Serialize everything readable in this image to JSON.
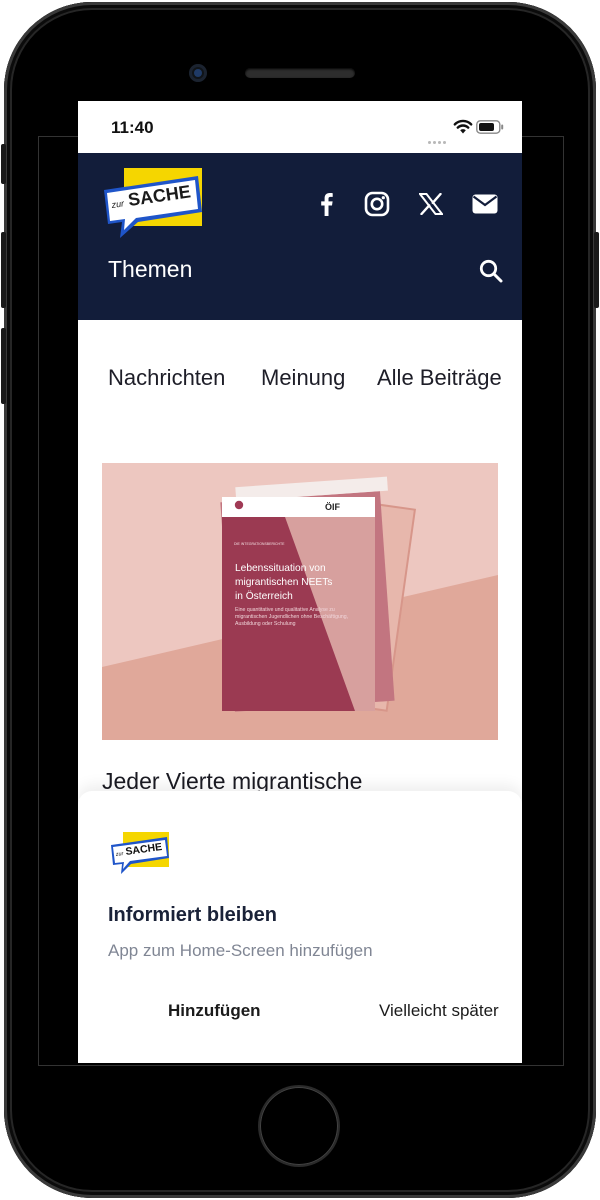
{
  "status_bar": {
    "time": "11:40"
  },
  "header": {
    "logo_text_small": "zur",
    "logo_text_main": "SACHE",
    "social_icons": [
      "facebook-icon",
      "instagram-icon",
      "x-icon",
      "mail-icon"
    ],
    "menu_label": "Themen",
    "search_icon": "search-icon"
  },
  "nav": {
    "items": [
      "Nachrichten",
      "Meinung",
      "Alle Beiträge"
    ]
  },
  "article": {
    "image": {
      "logo_right": "ÖIF",
      "eyebrow": "DIE INTEGRATIONSBERICHTE",
      "cover_title": "Lebenssituation von migrantischen NEETs in Österreich",
      "cover_subtitle": "Eine quantitative und qualitative Analyse zu migrantischen Jugendlichen ohne Beschäftigung, Ausbildung oder Schulung"
    },
    "title": "Jeder Vierte migrantische"
  },
  "install_prompt": {
    "title": "Informiert bleiben",
    "subtitle": "App zum Home-Screen hinzufügen",
    "add_label": "Hinzufügen",
    "later_label": "Vielleicht später"
  },
  "colors": {
    "header_bg": "#121d3a",
    "logo_yellow": "#f5d600",
    "logo_blue": "#1f55c9",
    "hero_bg": "#edc7c0",
    "report_cover": "#9b3a52"
  }
}
